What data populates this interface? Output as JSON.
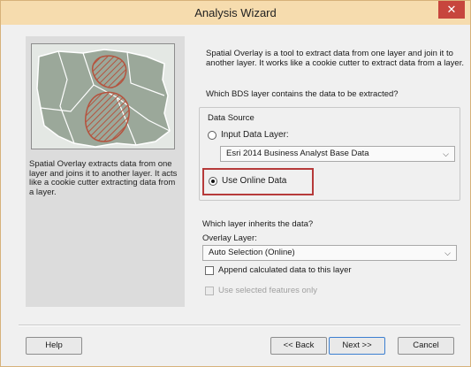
{
  "window": {
    "title": "Analysis Wizard",
    "close_icon": "close-icon"
  },
  "left_panel": {
    "image_icon": "map-illustration",
    "description": "Spatial Overlay extracts data from one layer and joins it to another layer. It acts like a cookie cutter extracting data from a layer."
  },
  "main": {
    "intro": "Spatial Overlay is a tool to extract data from one layer and join it to another layer. It works like a cookie cutter to extract data from a layer.",
    "question_source": "Which BDS layer contains the data to be extracted?",
    "data_source": {
      "group_label": "Data Source",
      "input_layer_label": "Input Data Layer:",
      "input_layer_value": "Esri 2014 Business Analyst Base Data",
      "online_label": "Use Online Data",
      "selected": "online"
    },
    "question_inherit": "Which layer inherits the data?",
    "overlay_layer_label": "Overlay Layer:",
    "overlay_layer_value": "Auto Selection (Online)",
    "append_label": "Append calculated data to this layer",
    "append_checked": false,
    "selected_features_label": "Use selected features only",
    "selected_features_enabled": false
  },
  "buttons": {
    "help": "Help",
    "back": "<< Back",
    "next": "Next >>",
    "cancel": "Cancel"
  },
  "colors": {
    "titlebar": "#f6dcae",
    "close": "#c7463d",
    "highlight": "#b63a3a",
    "hatch": "#b5533e"
  }
}
